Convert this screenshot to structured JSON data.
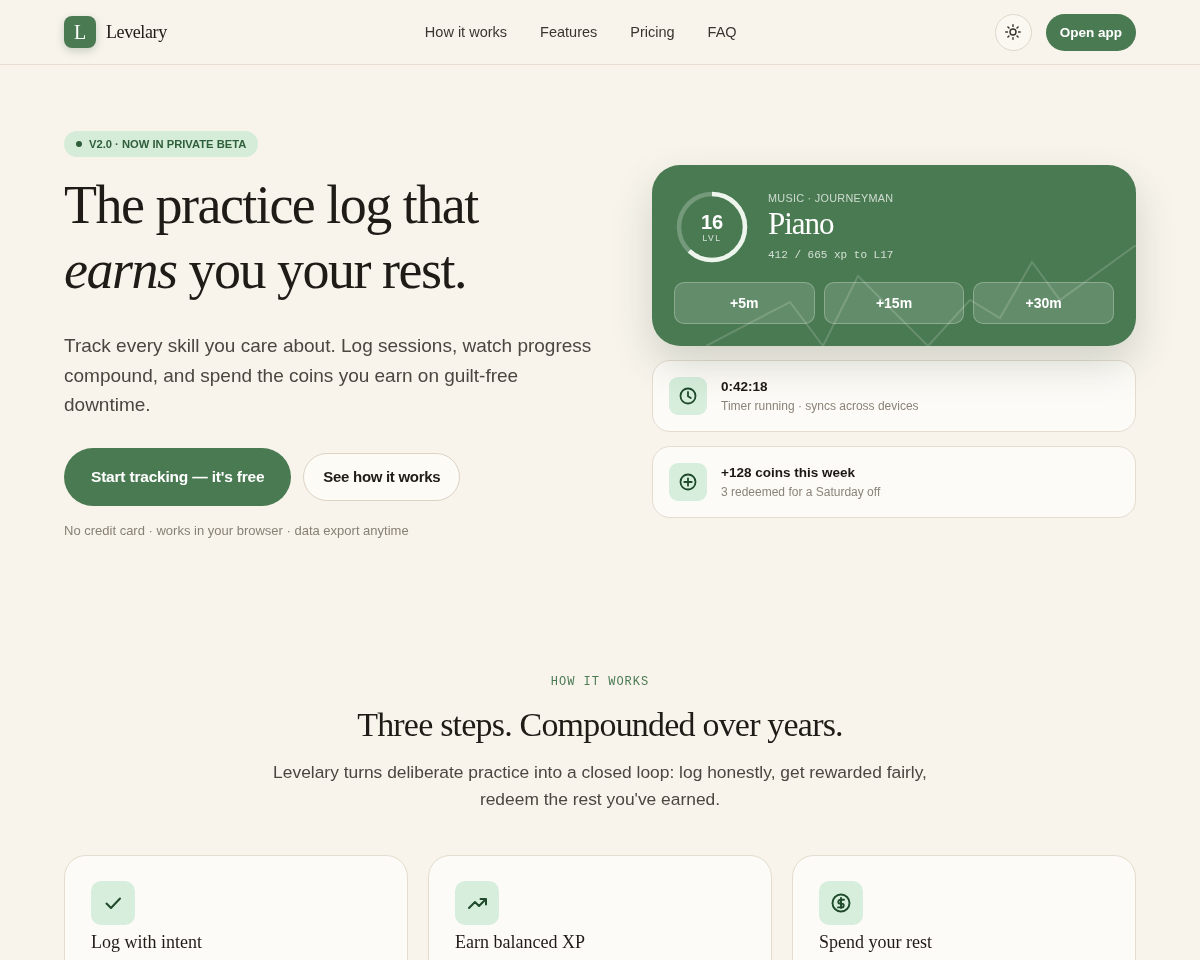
{
  "header": {
    "logo": {
      "mark": "L",
      "name": "Levelary"
    },
    "nav": [
      "How it works",
      "Features",
      "Pricing",
      "FAQ"
    ],
    "cta": "Open app"
  },
  "hero": {
    "badge": "V2.0 · NOW IN PRIVATE BETA",
    "headline": "The practice log that *earns* you your rest.",
    "lead": "Track every skill you care about. Log sessions, watch progress compound, and spend the coins you earn on guilt-free downtime.",
    "buttons": [
      {
        "label": "Start tracking — it's free",
        "kind": "primary"
      },
      {
        "label": "See how it works",
        "kind": "secondary"
      }
    ],
    "note": "No credit card · works in your browser · data export anytime"
  },
  "skill_card": {
    "level_number": "16",
    "level_label": "LVL",
    "level": 0.62,
    "category": "MUSIC · JOURNEYMAN",
    "skill": "Piano",
    "xp": "412 / 665 xp to L17",
    "buttons": [
      "+5m",
      "+15m",
      "+30m"
    ]
  },
  "status_cards": [
    {
      "kind": "timer",
      "title": "0:42:18",
      "subtitle": "Timer running · syncs across devices"
    },
    {
      "kind": "coins",
      "title": "+128 coins this week",
      "subtitle": "3 redeemed for a Saturday off"
    }
  ],
  "how_it_works": {
    "eyebrow": "HOW IT WORKS",
    "title": "Three steps. Compounded over years.",
    "intro": "Levelary turns deliberate practice into a closed loop: log honestly, get rewarded fairly, redeem the rest you've earned.",
    "steps": [
      {
        "kind": "log",
        "title": "Log with intent"
      },
      {
        "kind": "earn",
        "title": "Earn balanced XP"
      },
      {
        "kind": "spend",
        "title": "Spend your rest"
      }
    ]
  }
}
